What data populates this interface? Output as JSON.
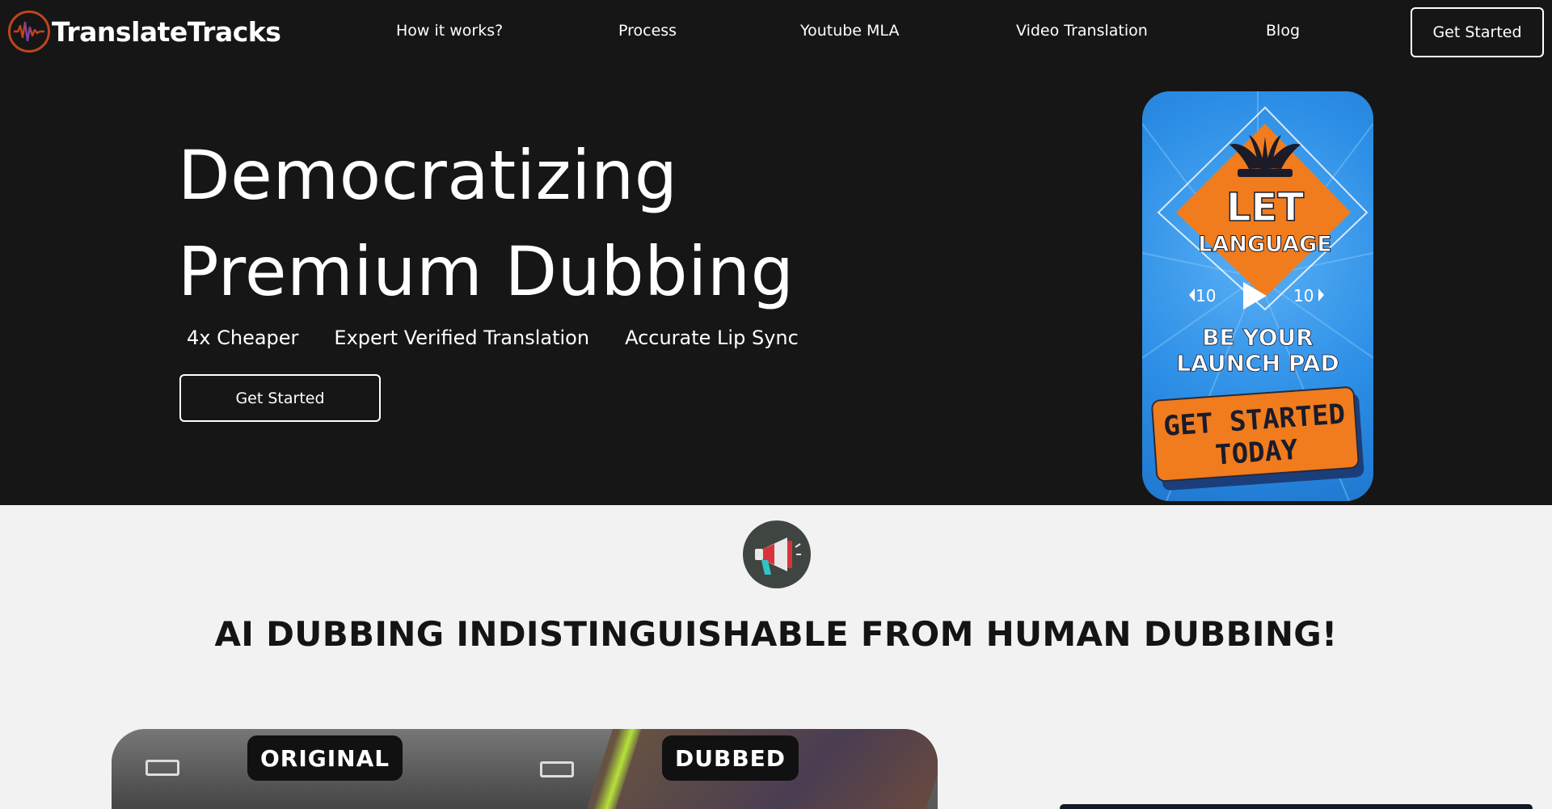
{
  "brand": {
    "name": "TranslateTracks",
    "colors": {
      "background_dark": "#161616",
      "background_light": "#f2f2f2",
      "accent": "#c0441f",
      "promo_blue": "#2d8fe6",
      "promo_orange": "#f07c1e"
    }
  },
  "nav": {
    "links": [
      {
        "label": "How it works?"
      },
      {
        "label": "Process"
      },
      {
        "label": "Youtube MLA"
      },
      {
        "label": "Video Translation"
      },
      {
        "label": "Blog"
      }
    ],
    "cta_label": "Get Started"
  },
  "hero": {
    "title_line1": "Democratizing",
    "title_line2": "Premium Dubbing",
    "features": [
      "4x Cheaper",
      "Expert Verified Translation",
      "Accurate Lip Sync"
    ],
    "cta_label": "Get Started"
  },
  "promo_video": {
    "headline_top": "LET",
    "headline_mid": "LANGUAGE",
    "rewind_label": "10",
    "forward_label": "10",
    "line_a": "BE YOUR",
    "line_b": "LAUNCH PAD",
    "cta_a": "GET STARTED",
    "cta_b": "TODAY"
  },
  "section": {
    "icon": "megaphone-icon",
    "heading": "AI DUBBING INDISTINGUISHABLE FROM HUMAN DUBBING!"
  },
  "comparison": {
    "original_label": "ORIGINAL",
    "dubbed_label": "DUBBED"
  }
}
